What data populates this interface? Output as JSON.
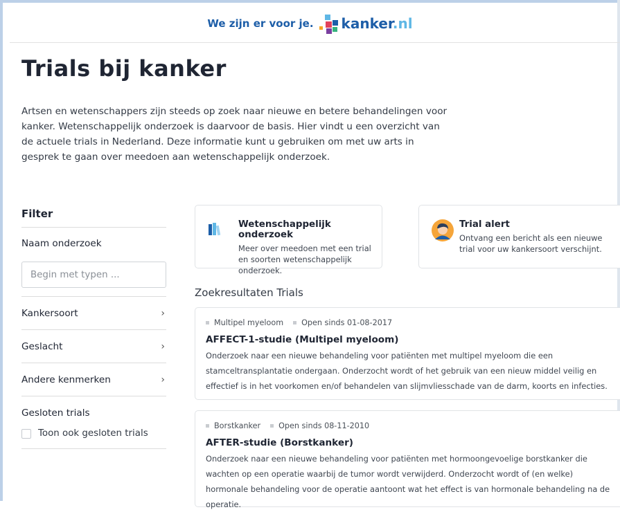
{
  "header": {
    "slogan": "We zijn er voor je.",
    "logo_main": "kanker",
    "logo_tld": ".nl",
    "colors": {
      "brand_blue": "#1d5ea8",
      "brand_light_blue": "#5fb7e5"
    }
  },
  "page": {
    "title": "Trials bij kanker",
    "intro": "Artsen en wetenschappers zijn steeds op zoek naar nieuwe en betere behandelingen voor kanker. Wetenschappelijk onderzoek is daarvoor de basis. Hier vindt u een overzicht van de actuele trials in Nederland. Deze informatie kunt u gebruiken om met uw arts in gesprek te gaan over meedoen aan wetenschappelijk onderzoek."
  },
  "filter": {
    "title": "Filter",
    "name_label": "Naam onderzoek",
    "search_placeholder": "Begin met typen ...",
    "rows": [
      {
        "label": "Kankersoort",
        "icon": "chevron-right-icon"
      },
      {
        "label": "Geslacht",
        "icon": "chevron-right-icon"
      },
      {
        "label": "Andere kenmerken",
        "icon": "chevron-right-icon"
      }
    ],
    "closed_label": "Gesloten trials",
    "closed_checkbox_label": "Toon ook gesloten trials",
    "closed_checked": false
  },
  "promos": [
    {
      "title": "Wetenschappelijk onderzoek",
      "text": "Meer over meedoen met een trial en soorten wetenschappelijk onderzoek.",
      "icon": "books-icon"
    },
    {
      "title": "Trial alert",
      "text": "Ontvang een bericht als een nieuwe trial voor uw kankersoort verschijnt.",
      "icon": "person-avatar-icon"
    }
  ],
  "results": {
    "heading": "Zoekresultaten Trials",
    "items": [
      {
        "cancer_type": "Multipel myeloom",
        "open_since": "Open sinds 01-08-2017",
        "title": "AFFECT-1-studie (Multipel myeloom)",
        "description": "Onderzoek naar een nieuwe behandeling voor patiënten met multipel myeloom die een stamceltransplantatie ondergaan. Onderzocht wordt of het gebruik van een nieuw middel veilig en effectief is in het voorkomen en/of behandelen van slijmvliesschade van de darm, koorts en infecties."
      },
      {
        "cancer_type": "Borstkanker",
        "open_since": "Open sinds 08-11-2010",
        "title": "AFTER-studie (Borstkanker)",
        "description": "Onderzoek naar een nieuwe behandeling voor patiënten met hormoongevoelige borstkanker die wachten op een operatie waarbij de tumor wordt verwijderd. Onderzocht wordt of (en welke) hormonale behandeling voor de operatie aantoont wat het effect is van hormonale behandeling na de operatie."
      }
    ]
  }
}
